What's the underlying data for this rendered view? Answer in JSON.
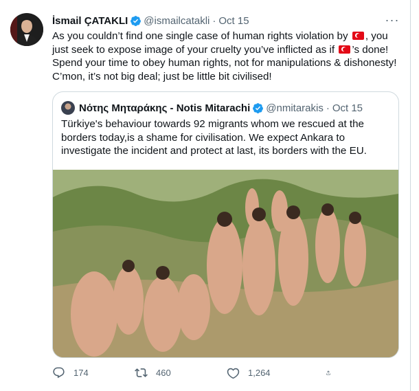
{
  "tweet": {
    "author_name": "İsmail ÇATAKLI",
    "author_handle": "@ismailcatakli",
    "separator": "·",
    "date": "Oct 15",
    "text_part1": "As you couldn’t find one single case of human rights violation by",
    "text_part2": ", you just seek to expose image of your cruelty you’ve inflicted as if",
    "text_part3": "’s done! Spend your time to obey human rights, not for manipulations & dishonesty! C’mon, it’s not big deal; just be little bit civilised!",
    "more_label": "···"
  },
  "quoted": {
    "author_name": "Νότης Μηταράκης - Notis Mitarachi",
    "author_handle": "@nmitarakis",
    "separator": "·",
    "date": "Oct 15",
    "text": "Türkiye's behaviour towards 92 migrants whom we rescued at the borders today,is a shame for civilisation. We expect Ankara to investigate the incident and protect at last, its borders with the EU."
  },
  "actions": {
    "replies": "174",
    "retweets": "460",
    "likes": "1,264"
  },
  "colors": {
    "verified_blue": "#1d9bf0",
    "secondary_text": "#536471",
    "flag_red": "#e30a17"
  },
  "icons": [
    "verified-badge-icon",
    "more-icon",
    "turkey-flag-icon",
    "reply-icon",
    "retweet-icon",
    "like-icon",
    "share-icon"
  ]
}
